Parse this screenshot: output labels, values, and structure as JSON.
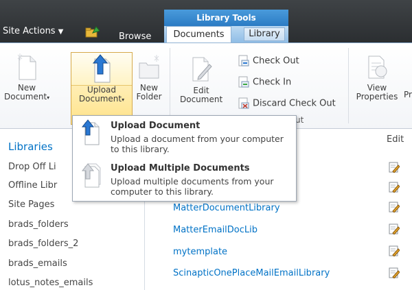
{
  "topbar": {
    "site_actions": "Site Actions",
    "browse": "Browse",
    "contextual_group": "Library Tools",
    "tab_documents": "Documents",
    "tab_library": "Library"
  },
  "ribbon": {
    "new_document_l1": "New",
    "new_document_l2": "Document",
    "upload_l1": "Upload",
    "upload_l2": "Document",
    "new_folder_l1": "New",
    "new_folder_l2": "Folder",
    "edit_l1": "Edit",
    "edit_l2": "Document",
    "check_out": "Check Out",
    "check_in": "Check In",
    "discard_check_out": "Discard Check Out",
    "group_label_fragment": "ut",
    "view_l1": "View",
    "view_l2": "Properties",
    "cut_fragment": "Pr"
  },
  "dropdown": {
    "items": [
      {
        "title": "Upload Document",
        "desc": "Upload a document from your computer to this library."
      },
      {
        "title": "Upload Multiple Documents",
        "desc": "Upload multiple documents from your computer to this library."
      }
    ]
  },
  "leftnav": {
    "title": "Libraries",
    "items": [
      "Drop Off Li",
      "Offline Libr",
      "Site Pages",
      "brads_folders",
      "brads_folders_2",
      "brads_emails",
      "lotus_notes_emails"
    ]
  },
  "content": {
    "edit_header": "Edit",
    "links": [
      "MatterDocumentLibrary",
      "MatterEmailDocLib",
      "mytemplate",
      "ScinapticOnePlaceMailEmailLibrary"
    ]
  },
  "colors": {
    "link": "#0072c6",
    "topbar": "#2b2e31",
    "context": "#2b7bc4",
    "highlight": "#ffe38a"
  }
}
